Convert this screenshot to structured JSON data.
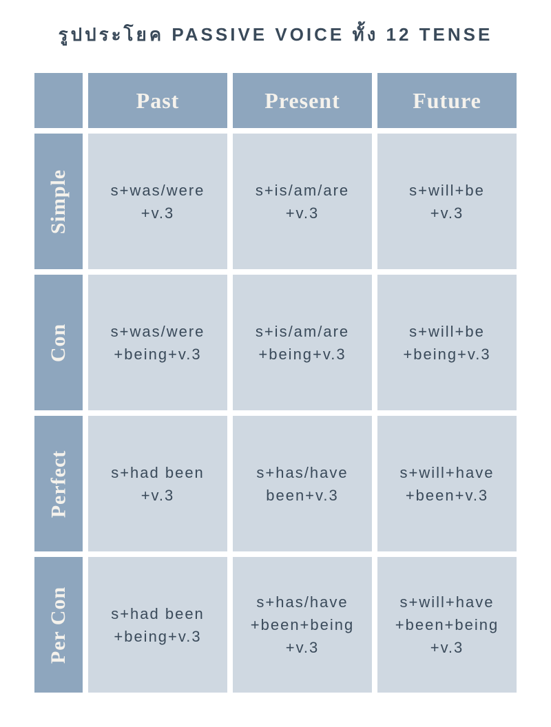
{
  "title": "รูปประโยค PASSIVE VOICE ทั้ง 12 TENSE",
  "columns": [
    "Past",
    "Present",
    "Future"
  ],
  "rows": [
    "Simple",
    "Con",
    "Perfect",
    "Per Con"
  ],
  "cells": {
    "simple": {
      "past": "s+was/were\n+v.3",
      "present": "s+is/am/are\n+v.3",
      "future": "s+will+be\n+v.3"
    },
    "con": {
      "past": "s+was/were\n+being+v.3",
      "present": "s+is/am/are\n+being+v.3",
      "future": "s+will+be\n+being+v.3"
    },
    "perfect": {
      "past": "s+had been\n+v.3",
      "present": "s+has/have\nbeen+v.3",
      "future": "s+will+have\n+been+v.3"
    },
    "percon": {
      "past": "s+had been\n+being+v.3",
      "present": "s+has/have\n+been+being\n+v.3",
      "future": "s+will+have\n+been+being\n+v.3"
    }
  }
}
